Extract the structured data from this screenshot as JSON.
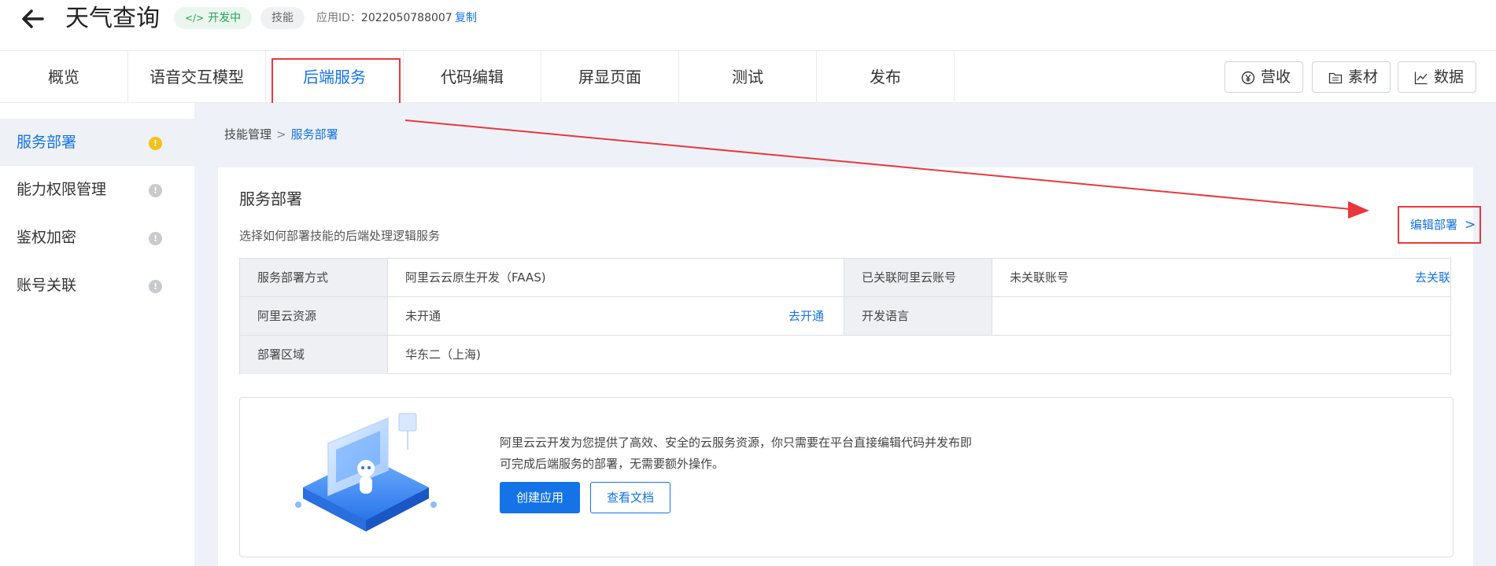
{
  "header": {
    "title": "天气查询",
    "status_badge": "开发中",
    "status_icon": "</>",
    "type_badge": "技能",
    "app_id_label": "应用ID：",
    "app_id": "2022050788007",
    "copy_label": "复制"
  },
  "tabs": [
    {
      "label": "概览"
    },
    {
      "label": "语音交互模型"
    },
    {
      "label": "后端服务",
      "active": true
    },
    {
      "label": "代码编辑"
    },
    {
      "label": "屏显页面"
    },
    {
      "label": "测试"
    },
    {
      "label": "发布"
    }
  ],
  "toolbar": {
    "revenue_label": "营收",
    "material_label": "素材",
    "data_label": "数据"
  },
  "sidebar": {
    "items": [
      {
        "label": "服务部署",
        "active": true,
        "status": "warning",
        "icon_text": "!"
      },
      {
        "label": "能力权限管理",
        "status": "info",
        "icon_text": "!"
      },
      {
        "label": "鉴权加密",
        "status": "info",
        "icon_text": "!"
      },
      {
        "label": "账号关联",
        "status": "info",
        "icon_text": "!"
      }
    ]
  },
  "breadcrumb": {
    "root": "技能管理",
    "separator": ">",
    "current": "服务部署"
  },
  "card": {
    "title": "服务部署",
    "description": "选择如何部署技能的后端处理逻辑服务",
    "edit_label": "编辑部署",
    "edit_chevron": ">"
  },
  "info_table": {
    "rows": [
      {
        "k1": "服务部署方式",
        "v1": "阿里云云原生开发（FAAS)",
        "k2": "已关联阿里云账号",
        "v2": "未关联账号",
        "action2": "去关联"
      },
      {
        "k1": "阿里云资源",
        "v1": "未开通",
        "action1": "去开通",
        "k2": "开发语言",
        "v2": ""
      },
      {
        "k1": "部署区域",
        "v1": "华东二（上海)"
      }
    ]
  },
  "promo": {
    "text": "阿里云云开发为您提供了高效、安全的云服务资源，你只需要在平台直接编辑代码并发布即可完成后端服务的部署，无需要额外操作。",
    "primary_button": "创建应用",
    "secondary_button": "查看文档"
  },
  "colors": {
    "accent": "#1473e6",
    "highlight": "#e8383d",
    "warning": "#f5c018",
    "dev_badge": "#27a05a"
  }
}
